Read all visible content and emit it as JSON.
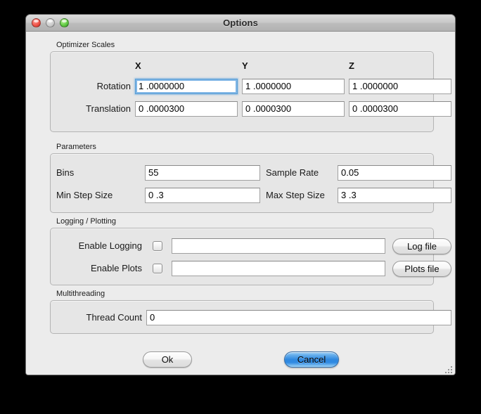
{
  "window": {
    "title": "Options",
    "traffic_lights": [
      "close-button",
      "minimize-button",
      "zoom-button"
    ]
  },
  "sections": {
    "optimizer_scales": {
      "label": "Optimizer Scales",
      "columns": [
        "X",
        "Y",
        "Z"
      ],
      "rows": [
        {
          "label": "Rotation",
          "values": [
            "1 .0000000",
            "1 .0000000",
            "1 .0000000"
          ],
          "focused_index": 0
        },
        {
          "label": "Translation",
          "values": [
            "0 .0000300",
            "0 .0000300",
            "0 .0000300"
          ],
          "focused_index": -1
        }
      ]
    },
    "parameters": {
      "label": "Parameters",
      "fields": [
        {
          "label": "Bins",
          "value": "55"
        },
        {
          "label": "Sample Rate",
          "value": "0.05"
        },
        {
          "label": "Min Step Size",
          "value": "0 .3"
        },
        {
          "label": "Max Step Size",
          "value": "3 .3"
        }
      ]
    },
    "logging_plotting": {
      "label": "Logging / Plotting",
      "rows": [
        {
          "label": "Enable Logging",
          "checked": false,
          "value": "",
          "button": "Log file"
        },
        {
          "label": "Enable Plots",
          "checked": false,
          "value": "",
          "button": "Plots file"
        }
      ]
    },
    "multithreading": {
      "label": "Multithreading",
      "fields": [
        {
          "label": "Thread Count",
          "value": "0"
        }
      ]
    }
  },
  "footer": {
    "ok_label": "Ok",
    "cancel_label": "Cancel"
  },
  "colors": {
    "accent_blue": "#2f88df",
    "focus_ring": "#6aa9e2",
    "window_bg": "#ececec",
    "group_bg": "#e6e6e6"
  }
}
